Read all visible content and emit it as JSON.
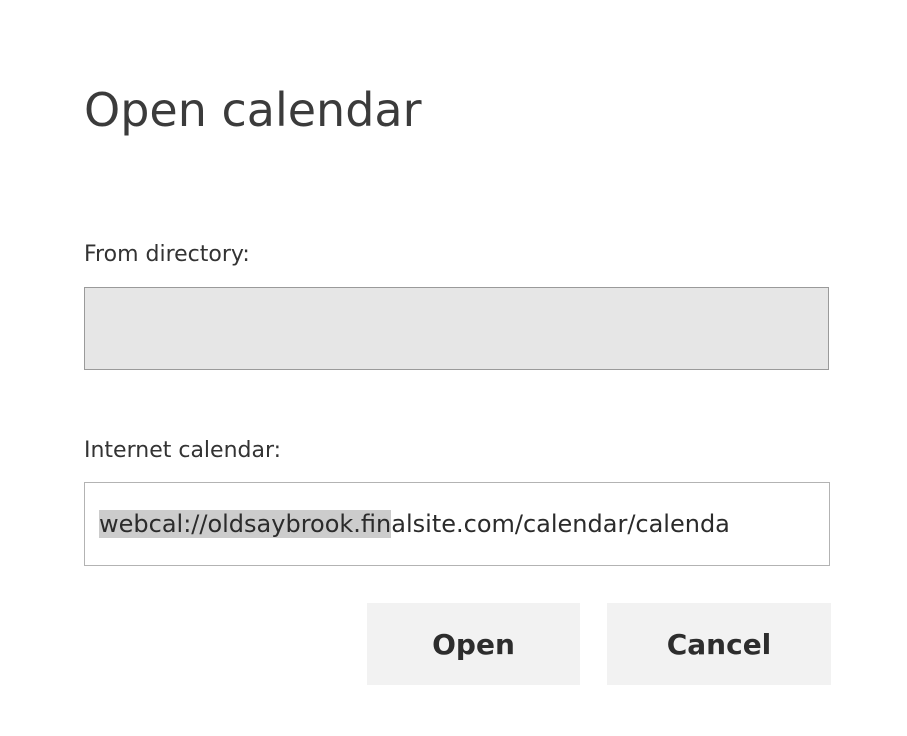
{
  "dialog": {
    "title": "Open calendar",
    "from_directory": {
      "label": "From directory:",
      "value": ""
    },
    "internet_calendar": {
      "label": "Internet calendar:",
      "value_selected_part": "webcal://oldsaybrook.fin",
      "value_rest": "alsite.com/calendar/calenda"
    },
    "buttons": {
      "open": "Open",
      "cancel": "Cancel"
    }
  }
}
